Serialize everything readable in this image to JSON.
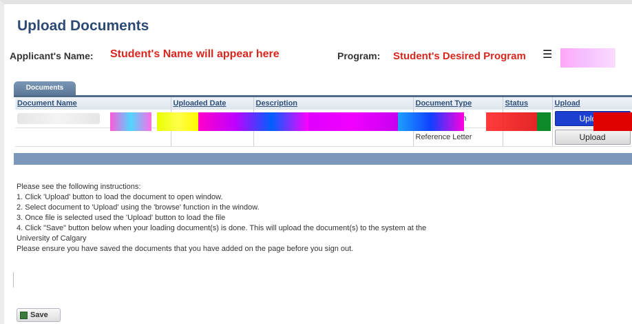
{
  "page": {
    "title": "Upload Documents",
    "applicant_label": "Applicant's Name:",
    "applicant_value": "Student's Name will appear here",
    "program_label": "Program:",
    "program_value": "Student's Desired Program"
  },
  "tabs": [
    {
      "label": "Documents"
    }
  ],
  "table": {
    "columns": [
      "Document Name",
      "Uploaded Date",
      "Description",
      "Document Type",
      "Status",
      "Upload"
    ],
    "rows": [
      {
        "document_name": "",
        "uploaded_date": "",
        "description": "",
        "document_type": "Evidence Form",
        "status": "",
        "upload_label": "Upload"
      },
      {
        "document_name": "",
        "uploaded_date": "",
        "description": "",
        "document_type": "Reference Letter",
        "status": "",
        "upload_label": "Upload"
      }
    ]
  },
  "instructions": [
    "Please see the following instructions:",
    "1. Click 'Upload' button to load the document to open window.",
    "2. Select document to 'Upload' using the 'browse' function in the window.",
    "3. Once file is selected used the 'Upload' button to load the file",
    "4. Click \"Save\" button below when your loading document(s) is done. This will upload the document(s) to the system at the",
    "University of Calgary",
    "Please ensure you have saved the documents that you have added on the page before you sign out."
  ],
  "actions": {
    "save_label": "Save"
  },
  "icons": {
    "menu": "menu-icon",
    "save": "save-icon"
  },
  "colors": {
    "title": "#2c4a73",
    "highlight": "#d8261e",
    "tab": "#5b7898",
    "band": "#7b98ba"
  }
}
